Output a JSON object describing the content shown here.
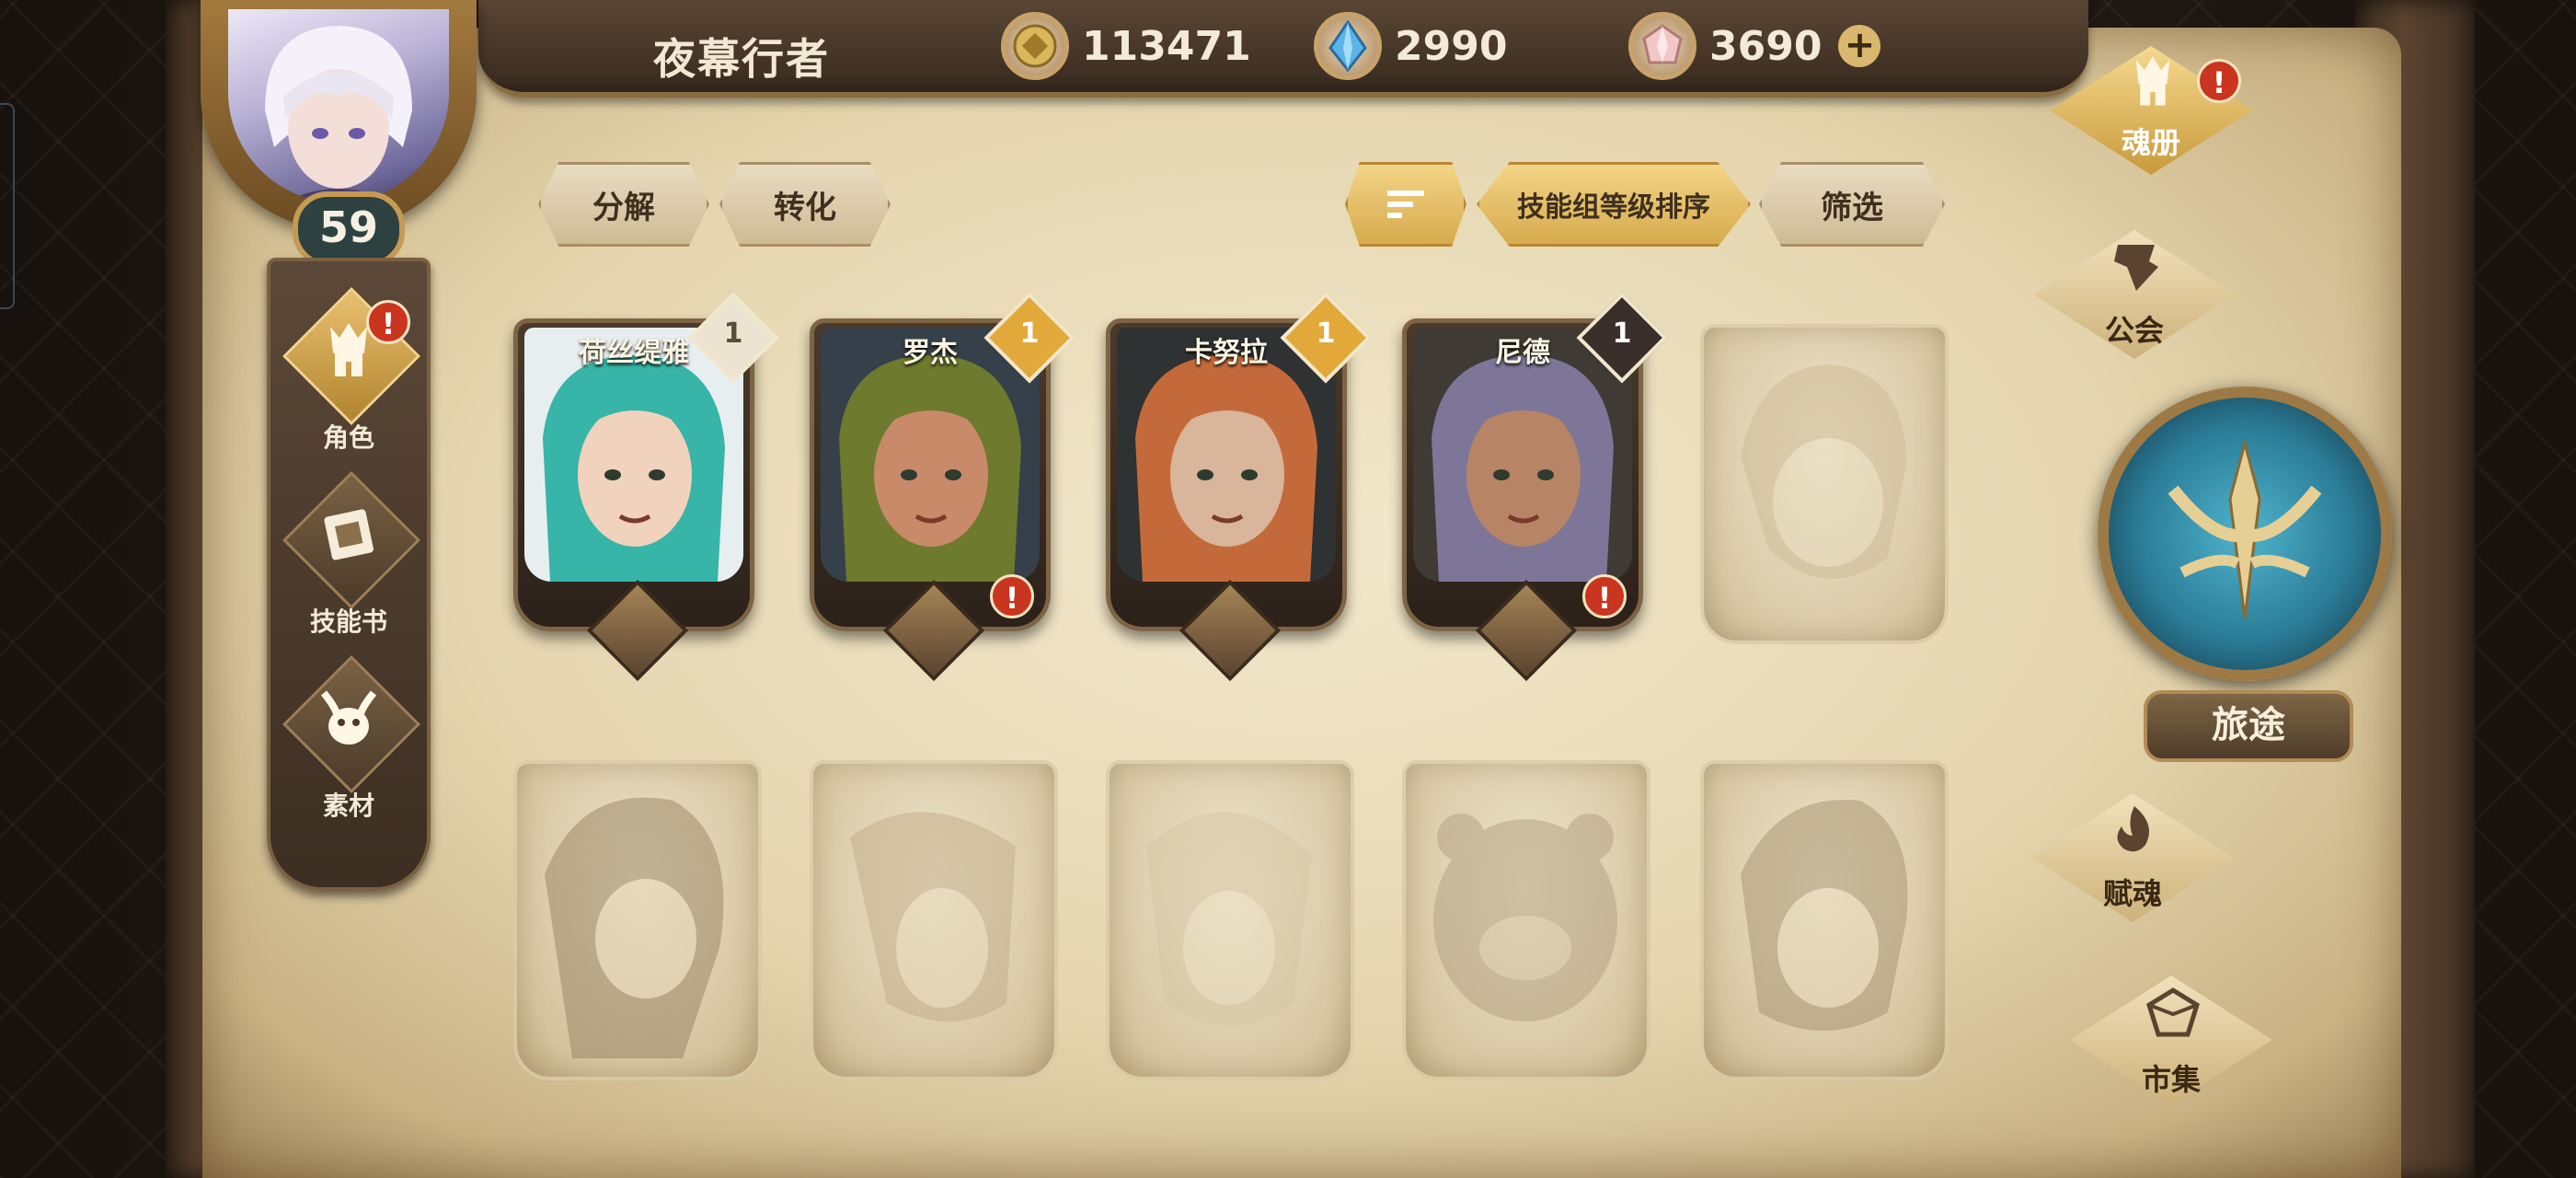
{
  "player": {
    "name": "夜幕行者",
    "level": "59"
  },
  "currencies": [
    {
      "icon": "gold-coin-icon",
      "value": "113471"
    },
    {
      "icon": "blue-crystal-icon",
      "value": "2990"
    },
    {
      "icon": "pink-gem-icon",
      "value": "3690"
    }
  ],
  "toolbar": {
    "decompose": "分解",
    "convert": "转化",
    "sort_label": "技能组等级排序",
    "filter": "筛选"
  },
  "left_nav": [
    {
      "label": "角色",
      "icon": "character-helmet-icon",
      "alert": "!"
    },
    {
      "label": "技能书",
      "icon": "skill-book-icon"
    },
    {
      "label": "素材",
      "icon": "material-creature-icon"
    }
  ],
  "cards": [
    {
      "name": "荷丝缇雅",
      "rank": "1",
      "rank_color": "#ece4d0",
      "rank_text": "#5a4a3a",
      "hair": "#36b5a8",
      "skin": "#f1d2bd",
      "bg": "#e7eef0",
      "alert": false
    },
    {
      "name": "罗杰",
      "rank": "1",
      "rank_color": "#e2a93a",
      "rank_text": "#ffffff",
      "hair": "#6e7a2e",
      "skin": "#c98a6a",
      "bg": "#36404a",
      "alert": true
    },
    {
      "name": "卡努拉",
      "rank": "1",
      "rank_color": "#e2a93a",
      "rank_text": "#ffffff",
      "hair": "#c46a3a",
      "skin": "#d8b59b",
      "bg": "#2f3233",
      "alert": false
    },
    {
      "name": "尼德",
      "rank": "1",
      "rank_color": "#3b2f2b",
      "rank_text": "#ffffff",
      "hair": "#7d7698",
      "skin": "#b88466",
      "bg": "#3f3a34",
      "alert": true
    }
  ],
  "alert_symbol": "!",
  "right_nav": {
    "soul_book": "魂册",
    "guild": "公会",
    "journey": "旅途",
    "soul_grant": "赋魂",
    "market": "市集",
    "alert": "!"
  },
  "plus_symbol": "+"
}
